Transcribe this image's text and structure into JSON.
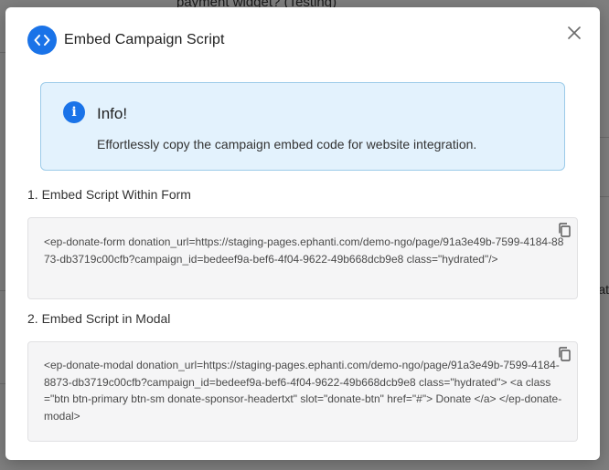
{
  "background": {
    "heading_fragment": "payment widget? (Testing)",
    "right_fragment": "at"
  },
  "modal": {
    "title": "Embed Campaign Script",
    "title_icon": "code-icon",
    "close_icon": "close-icon"
  },
  "info": {
    "icon": "info-icon",
    "title": "Info!",
    "text": "Effortlessly copy the campaign embed code for website integration."
  },
  "sections": [
    {
      "label": "1. Embed Script Within Form",
      "code": "<ep-donate-form donation_url=https://staging-pages.ephanti.com/demo-ngo/page/91a3e49b-7599-4184-8873-db3719c00cfb?campaign_id=bedeef9a-bef6-4f04-9622-49b668dcb9e8 class=\"hydrated\"/>",
      "copy_icon": "copy-icon"
    },
    {
      "label": "2. Embed Script in Modal",
      "code": "<ep-donate-modal donation_url=https://staging-pages.ephanti.com/demo-ngo/page/91a3e49b-7599-4184-8873-db3719c00cfb?campaign_id=bedeef9a-bef6-4f04-9622-49b668dcb9e8 class=\"hydrated\"> <a class=\"btn btn-primary btn-sm donate-sponsor-headertxt\" slot=\"donate-btn\" href=\"#\"> Donate </a> </ep-donate-modal>",
      "copy_icon": "copy-icon"
    }
  ],
  "colors": {
    "accent": "#1a73e8",
    "alert_bg": "#e3f2fd",
    "alert_border": "#9ccbe9",
    "code_bg": "#f5f5f6"
  }
}
